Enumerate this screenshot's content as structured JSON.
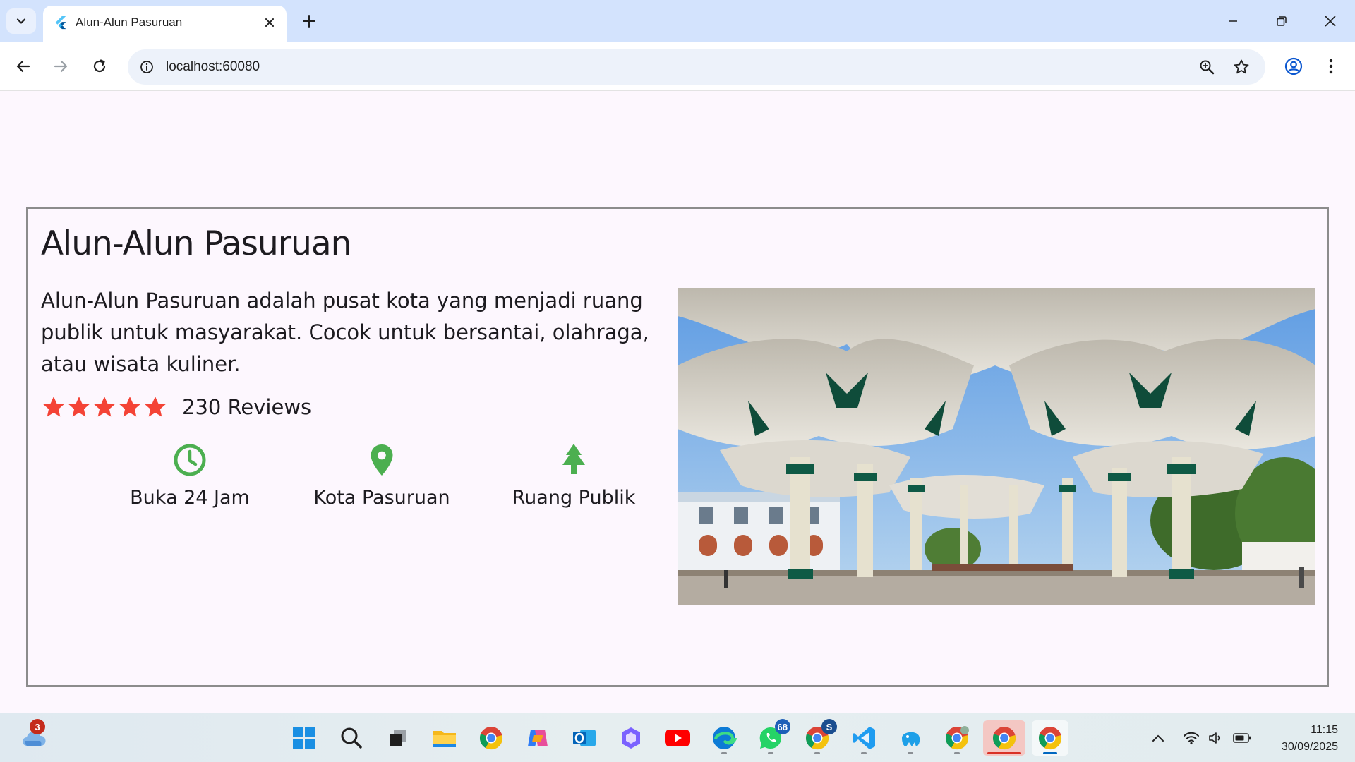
{
  "browser": {
    "tab_title": "Alun-Alun Pasuruan",
    "url": "localhost:60080",
    "icons": [
      "tab-search-icon",
      "flutter-icon",
      "close-icon",
      "plus-icon",
      "minimize-icon",
      "restore-icon",
      "close-window-icon",
      "back-arrow-icon",
      "forward-arrow-icon",
      "reload-icon",
      "site-info-icon",
      "zoom-icon",
      "star-icon",
      "profile-icon",
      "kebab-menu-icon"
    ]
  },
  "place": {
    "title": "Alun-Alun Pasuruan",
    "description": "Alun-Alun Pasuruan adalah pusat kota yang menjadi ruang publik untuk masyarakat. Cocok untuk bersantai, olahraga, atau wisata kuliner.",
    "rating_stars": 5,
    "reviews": "230 Reviews",
    "star_color": "#f44336",
    "features": [
      {
        "icon": "clock-icon",
        "label": "Buka 24 Jam"
      },
      {
        "icon": "location-pin-icon",
        "label": "Kota Pasuruan"
      },
      {
        "icon": "tree-icon",
        "label": "Ruang Publik"
      }
    ],
    "feature_icon_color": "#4caf50",
    "image": "photo of giant white umbrella canopies with green columns at a city square"
  },
  "taskbar": {
    "weather_badge": "3",
    "whatsapp_badge": "68",
    "chrome_s_badge": "S",
    "apps": [
      "weather-icon",
      "windows-start-icon",
      "search-icon",
      "task-view-icon",
      "file-explorer-icon",
      "chrome-icon",
      "copilot-icon",
      "outlook-icon",
      "microsoft365-icon",
      "youtube-icon",
      "edge-icon",
      "whatsapp-icon",
      "chrome-profile-icon",
      "vscode-icon",
      "elephant-app-icon",
      "chrome-guest-icon",
      "chrome-active-icon",
      "chrome-icon-2"
    ],
    "time": "11:15",
    "date": "30/09/2025"
  }
}
